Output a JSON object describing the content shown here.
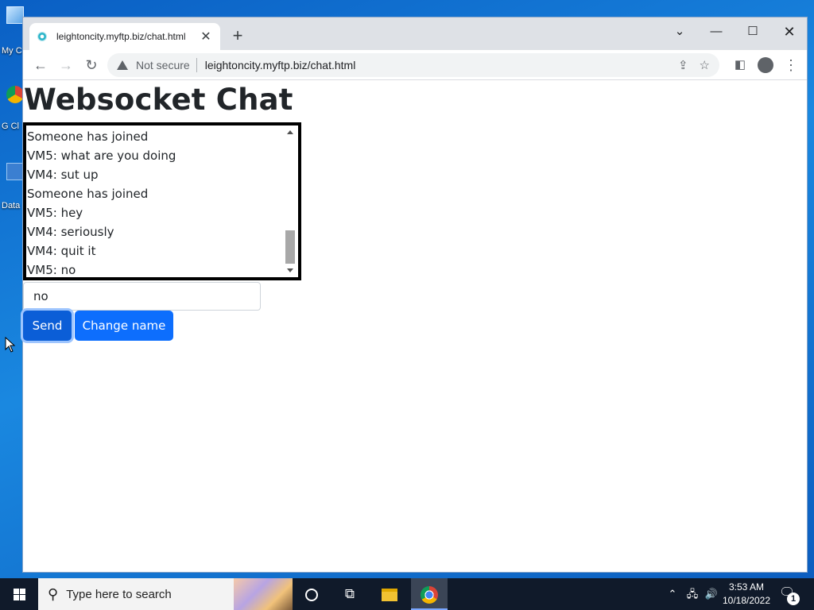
{
  "desktop": {
    "icons": [
      {
        "label": "My C",
        "icon": "computer-icon"
      },
      {
        "label": "G Cl",
        "icon": "chrome-icon"
      },
      {
        "label": "Data",
        "icon": "shortcut-icon"
      }
    ]
  },
  "browser": {
    "tab_title": "leightoncity.myftp.biz/chat.html",
    "tab_close": "✕",
    "new_tab": "+",
    "security_label": "Not secure",
    "url": "leightoncity.myftp.biz/chat.html"
  },
  "page": {
    "title": "Websocket Chat",
    "messages": [
      "Someone has joined",
      "VM5: what are you doing",
      "VM4: sut up",
      "Someone has joined",
      "VM5: hey",
      "VM4: seriously",
      "VM4: quit it",
      "VM5: no"
    ],
    "input_value": "no",
    "send_label": "Send",
    "change_name_label": "Change name"
  },
  "taskbar": {
    "search_placeholder": "Type here to search",
    "time": "3:53 AM",
    "date": "10/18/2022",
    "notification_count": "1"
  }
}
